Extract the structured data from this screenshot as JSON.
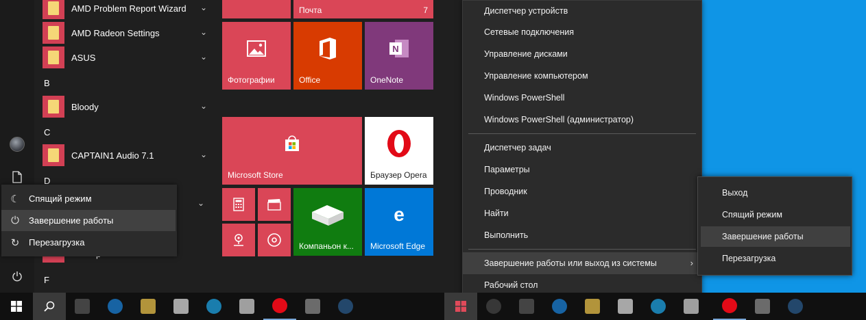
{
  "start_menu": {
    "apps": [
      {
        "label": "AMD Problem Report Wizard",
        "chevron": true
      },
      {
        "label": "AMD Radeon Settings",
        "chevron": true
      },
      {
        "label": "ASUS",
        "chevron": true
      },
      {
        "label": "Bloody",
        "chevron": true
      },
      {
        "label": "CAPTAIN1 Audio 7.1",
        "chevron": true
      }
    ],
    "letters": [
      "B",
      "C",
      "D",
      "F"
    ],
    "partial_app_suffix": "р",
    "power_menu": {
      "items": [
        {
          "label": "Спящий режим",
          "icon": "moon-icon"
        },
        {
          "label": "Завершение работы",
          "icon": "power-icon",
          "selected": true
        },
        {
          "label": "Перезагрузка",
          "icon": "restart-icon"
        }
      ]
    },
    "tiles": {
      "mail": {
        "label": "Почта",
        "badge": "7"
      },
      "photos": {
        "label": "Фотографии"
      },
      "office": {
        "label": "Office"
      },
      "onenote": {
        "label": "OneNote"
      },
      "store": {
        "label": "Microsoft Store"
      },
      "opera": {
        "label": "Браузер Opera"
      },
      "companion": {
        "label": "Компаньон к..."
      },
      "edge": {
        "label": "Microsoft Edge"
      }
    }
  },
  "winx_menu": {
    "group1": [
      "Диспетчер устройств",
      "Сетевые подключения",
      "Управление дисками",
      "Управление компьютером",
      "Windows PowerShell",
      "Windows PowerShell (администратор)"
    ],
    "group2": [
      "Диспетчер задач",
      "Параметры",
      "Проводник",
      "Найти",
      "Выполнить"
    ],
    "shutdown_item": "Завершение работы или выход из системы",
    "desktop_item": "Рабочий стол",
    "submenu": [
      {
        "label": "Выход"
      },
      {
        "label": "Спящий режим"
      },
      {
        "label": "Завершение работы",
        "selected": true
      },
      {
        "label": "Перезагрузка"
      }
    ]
  },
  "colors": {
    "tile_red": "#da4657",
    "office_orange": "#d83b01",
    "onenote_purple": "#80397b",
    "xbox_green": "#107c10",
    "edge_blue": "#0078d7",
    "desktop_blue": "#0f95e6",
    "menu_bg": "#2b2b2b",
    "menu_selected": "#404040"
  }
}
